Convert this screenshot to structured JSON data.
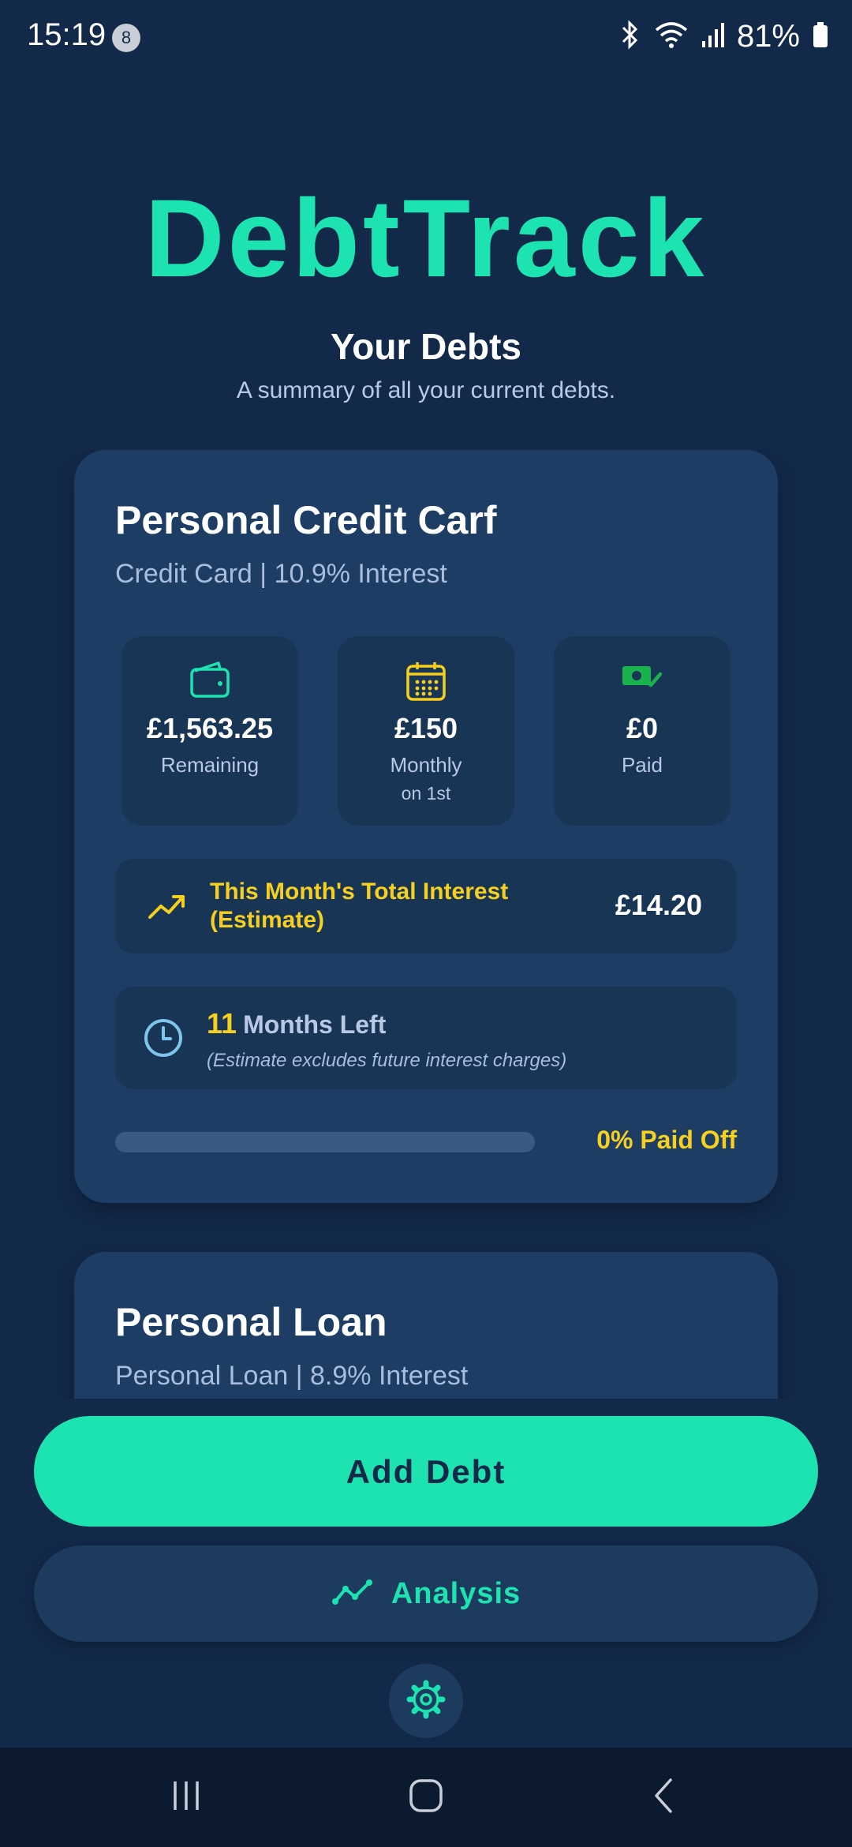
{
  "status_bar": {
    "time": "15:19",
    "notification_count": "8",
    "battery": "81%"
  },
  "header": {
    "app_title": "DebtTrack",
    "section_title": "Your Debts",
    "section_subtitle": "A summary of all your current debts."
  },
  "debts": [
    {
      "name": "Personal Credit Carf",
      "subtitle": "Credit Card  | 10.9% Interest",
      "stats": [
        {
          "icon": "wallet-icon",
          "value": "£1,563.25",
          "label": "Remaining"
        },
        {
          "icon": "calendar-icon",
          "value": "£150",
          "label": "Monthly",
          "note": "on 1st"
        },
        {
          "icon": "cash-check-icon",
          "value": "£0",
          "label": "Paid"
        }
      ],
      "interest_label": "This Month's Total Interest (Estimate)",
      "interest_value": "£14.20",
      "months_number": "11",
      "months_label": "Months Left",
      "months_note": "(Estimate excludes future interest charges)",
      "progress_fraction": 0,
      "progress_label": "0% Paid Off"
    },
    {
      "name": "Personal Loan",
      "subtitle": "Personal Loan  | 8.9% Interest"
    }
  ],
  "actions": {
    "add_label": "Add Debt",
    "analysis_label": "Analysis"
  },
  "colors": {
    "background": "#13294a",
    "card": "#1d3d64",
    "accent": "#1de3b1",
    "highlight": "#f6cf1f",
    "muted_text": "#b9c8e4"
  }
}
